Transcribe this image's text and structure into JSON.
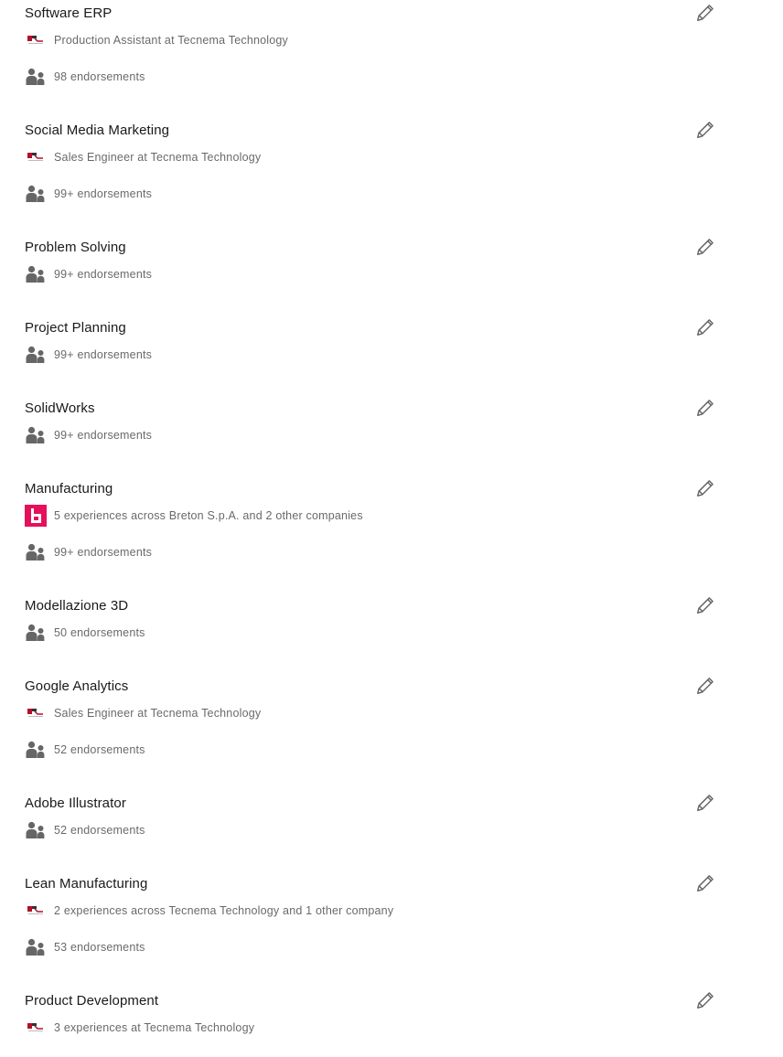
{
  "skills": [
    {
      "name": "Software ERP",
      "context": {
        "logo": "tecnema-logo",
        "text": "Production Assistant at Tecnema Technology"
      },
      "endorsements": "98 endorsements"
    },
    {
      "name": "Social Media Marketing",
      "context": {
        "logo": "tecnema-logo",
        "text": "Sales Engineer at Tecnema Technology"
      },
      "endorsements": "99+ endorsements"
    },
    {
      "name": "Problem Solving",
      "context": null,
      "endorsements": "99+ endorsements"
    },
    {
      "name": "Project Planning",
      "context": null,
      "endorsements": "99+ endorsements"
    },
    {
      "name": "SolidWorks",
      "context": null,
      "endorsements": "99+ endorsements"
    },
    {
      "name": "Manufacturing",
      "context": {
        "logo": "breton-logo",
        "text": "5 experiences across Breton S.p.A. and 2 other companies"
      },
      "endorsements": "99+ endorsements"
    },
    {
      "name": "Modellazione 3D",
      "context": null,
      "endorsements": "50 endorsements"
    },
    {
      "name": "Google Analytics",
      "context": {
        "logo": "tecnema-logo",
        "text": "Sales Engineer at Tecnema Technology"
      },
      "endorsements": "52 endorsements"
    },
    {
      "name": "Adobe Illustrator",
      "context": null,
      "endorsements": "52 endorsements"
    },
    {
      "name": "Lean Manufacturing",
      "context": {
        "logo": "tecnema-logo",
        "text": "2 experiences across Tecnema Technology and 1 other company"
      },
      "endorsements": "53 endorsements"
    },
    {
      "name": "Product Development",
      "context": {
        "logo": "tecnema-logo",
        "text": "3 experiences at Tecnema Technology"
      },
      "endorsements": null
    }
  ],
  "icons": {
    "edit": "pencil-icon",
    "endorsement": "people-icon"
  },
  "colors": {
    "icon_gray": "#666666",
    "breton_brand": "#e4105b",
    "tecnema_red": "#b0122a"
  }
}
